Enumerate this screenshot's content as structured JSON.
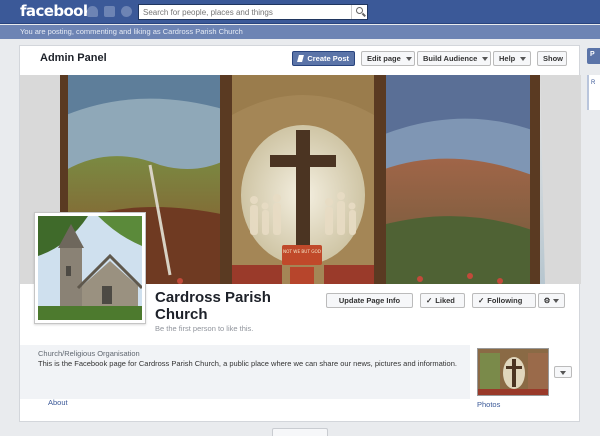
{
  "topbar": {
    "logo": "facebook",
    "search_placeholder": "Search for people, places and things",
    "icons": [
      "friends-icon",
      "messages-icon",
      "notifications-globe-icon",
      "search-icon"
    ]
  },
  "postbar": {
    "text": "You are posting, commenting and liking as Cardross Parish Church"
  },
  "admin": {
    "title": "Admin Panel",
    "create_post": "Create Post",
    "edit_page": "Edit page",
    "build_audience": "Build Audience",
    "help": "Help",
    "show": "Show"
  },
  "page": {
    "name": "Cardross Parish Church",
    "like_note": "Be the first person to like this.",
    "update_info": "Update Page Info",
    "liked": "Liked",
    "following": "Following",
    "category": "Church/Religious Organisation",
    "description": "This is the Facebook page for Cardross Parish Church, a public place where we can share our news, pictures and information.",
    "about": "About",
    "photos": "Photos"
  },
  "cover": {
    "banner_text": "NOT WE BUT GOD"
  },
  "right_edge": {
    "stub": "P",
    "panel": "R"
  },
  "colors": {
    "brand": "#3b5998",
    "bar": "#6d84b4",
    "button_blue": "#5b74a8"
  }
}
